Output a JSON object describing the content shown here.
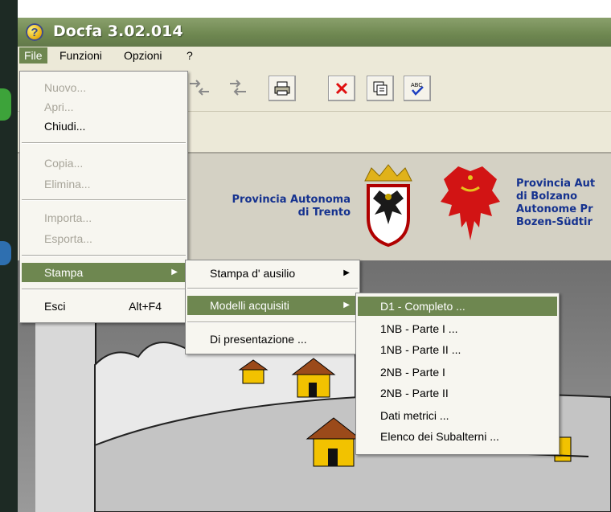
{
  "app": {
    "title": "Docfa 3.02.014"
  },
  "menubar": {
    "items": [
      "File",
      "Funzioni",
      "Opzioni",
      "?"
    ]
  },
  "file_menu": {
    "items": [
      {
        "label": "Nuovo...",
        "enabled": false
      },
      {
        "label": "Apri...",
        "enabled": false
      },
      {
        "label": "Chiudi...",
        "enabled": true
      },
      {
        "label": "Copia...",
        "enabled": false
      },
      {
        "label": "Elimina...",
        "enabled": false
      },
      {
        "label": "Importa...",
        "enabled": false
      },
      {
        "label": "Esporta...",
        "enabled": false
      },
      {
        "label": "Stampa",
        "enabled": true,
        "highlighted": true
      },
      {
        "label": "Esci",
        "shortcut": "Alt+F4",
        "enabled": true
      }
    ]
  },
  "stampa_submenu": {
    "items": [
      {
        "label": "Stampa d' ausilio"
      },
      {
        "label": "Modelli acquisiti",
        "highlighted": true
      },
      {
        "label": "Di presentazione ..."
      }
    ]
  },
  "modelli_submenu": {
    "items": [
      {
        "label": "D1  - Completo ...",
        "highlighted": true
      },
      {
        "label": "1NB - Parte I  ..."
      },
      {
        "label": "1NB - Parte II  ..."
      },
      {
        "label": "2NB - Parte I"
      },
      {
        "label": "2NB - Parte II"
      },
      {
        "label": "Dati metrici ..."
      },
      {
        "label": "Elenco dei Subalterni ..."
      }
    ]
  },
  "banner": {
    "trento_line1": "Provincia Autonoma",
    "trento_line2": "di Trento",
    "bolzano_line1": "Provincia Aut",
    "bolzano_line2": "di Bolzano",
    "bolzano_line3": "Autonome Pr",
    "bolzano_line4": "Bozen-Südtir"
  },
  "toolbar": {
    "icons": [
      "move-left-icon",
      "move-right-icon",
      "print-icon",
      "delete-icon",
      "copy-icon",
      "spellcheck-icon"
    ]
  },
  "colors": {
    "accent": "#6e8750",
    "banner_text": "#15328f"
  }
}
